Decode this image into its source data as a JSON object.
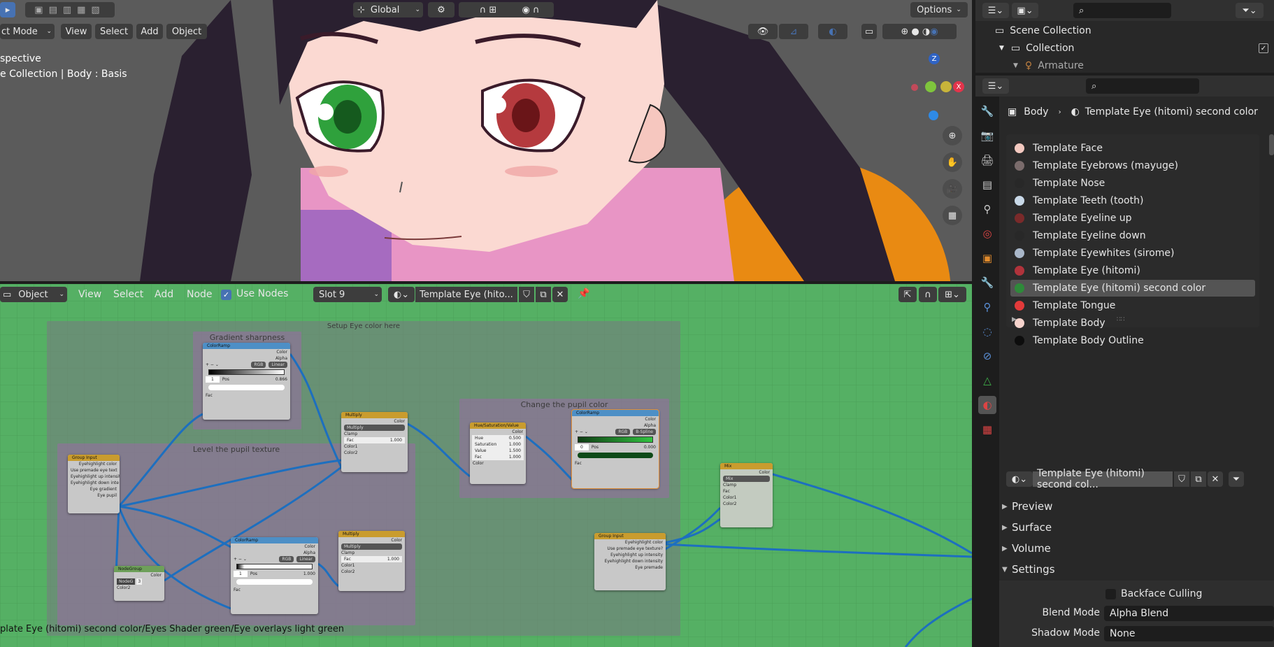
{
  "viewport": {
    "mode": "ct Mode",
    "menus": [
      "View",
      "Select",
      "Add",
      "Object"
    ],
    "transform_orientation": "Global",
    "options_label": "Options",
    "info_line1": "spective",
    "info_line2": "e Collection | Body : Basis",
    "gizmo_axes": {
      "z": "Z",
      "x": "X"
    }
  },
  "node_editor": {
    "mode": "Object",
    "menus": [
      "View",
      "Select",
      "Add",
      "Node"
    ],
    "use_nodes_label": "Use Nodes",
    "slot": "Slot 9",
    "material_name": "Template Eye (hito...",
    "breadcrumb": "plate Eye (hitomi) second color/Eyes Shader green/Eye overlays light green",
    "frames": {
      "setup": "Setup Eye color here",
      "gradient": "Gradient sharpness",
      "level": "Level the pupil texture",
      "change": "Change the pupil color"
    },
    "nodes": {
      "colorramp1": {
        "title": "ColorRamp",
        "out1": "Color",
        "out2": "Alpha",
        "mode": "RGB",
        "interp": "Linear",
        "idx": "1",
        "pos_label": "Pos",
        "pos": "0.866",
        "in": "Fac"
      },
      "multiply1": {
        "title": "Multiply",
        "out": "Color",
        "op": "Multiply",
        "clamp": "Clamp",
        "fac": "Fac",
        "fac_val": "1.000",
        "c1": "Color1",
        "c2": "Color2"
      },
      "hsv": {
        "title": "Hue/Saturation/Value",
        "out": "Color",
        "hue": "Hue",
        "hue_v": "0.500",
        "sat": "Saturation",
        "sat_v": "1.000",
        "val": "Value",
        "val_v": "1.500",
        "fac": "Fac",
        "fac_v": "1.000",
        "color": "Color"
      },
      "colorramp2": {
        "title": "ColorRamp",
        "out1": "Color",
        "out2": "Alpha",
        "mode": "RGB",
        "interp": "B-Spline",
        "idx": "0",
        "pos_label": "Pos",
        "pos": "0.000",
        "in": "Fac"
      },
      "mix": {
        "title": "Mix",
        "out": "Color",
        "op": "Mix",
        "clamp": "Clamp",
        "fac": "Fac",
        "c1": "Color1",
        "c2": "Color2"
      },
      "groupinput1": {
        "title": "Group Input",
        "rows": [
          "Eyehighlight color",
          "Use premade eye text",
          "Eyehighlight up intensit",
          "Eyehighlight down inte",
          "Eye gradient",
          "Eye pupil"
        ]
      },
      "groupinput2": {
        "title": "Group Input",
        "rows": [
          "Eyehighlight color",
          "Use premade eye texture?",
          "Eyehighlight up intensity",
          "Eyehighlight down intensity",
          "Eye premade"
        ]
      },
      "nodegroup": {
        "title": "NodeGroup",
        "out": "Color",
        "field": "NodeG",
        "num": "3",
        "in": "Color2"
      },
      "colorramp3": {
        "title": "ColorRamp",
        "out1": "Color",
        "out2": "Alpha",
        "mode": "RGB",
        "interp": "Linear",
        "idx": "1",
        "pos_label": "Pos",
        "pos": "1.000",
        "in": "Fac"
      },
      "multiply2": {
        "title": "Multiply",
        "out": "Color",
        "op": "Multiply",
        "clamp": "Clamp",
        "fac": "Fac",
        "fac_val": "1.000",
        "c1": "Color1",
        "c2": "Color2"
      }
    }
  },
  "outliner": {
    "items": [
      {
        "label": "Scene Collection"
      },
      {
        "label": "Collection"
      },
      {
        "label": "Armature"
      }
    ]
  },
  "properties": {
    "breadcrumb_object": "Body",
    "breadcrumb_material": "Template Eye (hitomi) second color",
    "materials": [
      {
        "name": "Template Face",
        "color": "#f3c9c0"
      },
      {
        "name": "Template Eyebrows (mayuge)",
        "color": "#7a6b6b"
      },
      {
        "name": "Template Nose",
        "color": "#282828"
      },
      {
        "name": "Template Teeth (tooth)",
        "color": "#c9d9e8"
      },
      {
        "name": "Template Eyeline up",
        "color": "#7a2a2a"
      },
      {
        "name": "Template Eyeline down",
        "color": "#282828"
      },
      {
        "name": "Template Eyewhites (sirome)",
        "color": "#a9b7c9"
      },
      {
        "name": "Template Eye (hitomi)",
        "color": "#b0333b"
      },
      {
        "name": "Template Eye (hitomi) second color",
        "color": "#2e8a3a"
      },
      {
        "name": "Template Tongue",
        "color": "#e23a3a"
      },
      {
        "name": "Template Body",
        "color": "#f6d3cc"
      },
      {
        "name": "Template Body Outline",
        "color": "#0d0d0d"
      }
    ],
    "selected_index": 8,
    "material_field": "Template Eye (hitomi) second col...",
    "panels": {
      "preview": "Preview",
      "surface": "Surface",
      "volume": "Volume",
      "settings": "Settings"
    },
    "settings": {
      "backface_culling": "Backface Culling",
      "blend_mode_label": "Blend Mode",
      "blend_mode_value": "Alpha Blend",
      "shadow_mode_label": "Shadow Mode",
      "shadow_mode_value": "None"
    }
  }
}
